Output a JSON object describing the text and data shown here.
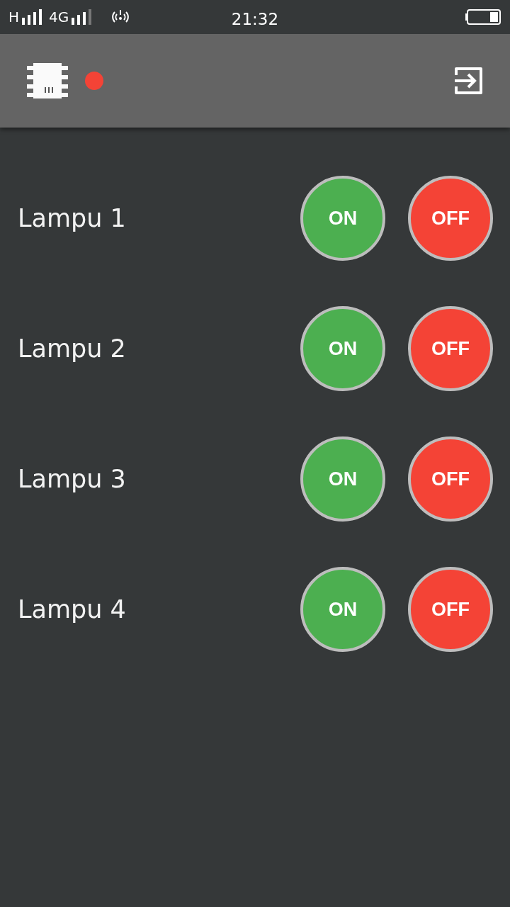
{
  "status_bar": {
    "network_1": "H",
    "network_2": "4G",
    "time": "21:32"
  },
  "toolbar": {
    "connected": false
  },
  "lamps": [
    {
      "name": "Lampu 1",
      "on_label": "ON",
      "off_label": "OFF"
    },
    {
      "name": "Lampu 2",
      "on_label": "ON",
      "off_label": "OFF"
    },
    {
      "name": "Lampu 3",
      "on_label": "ON",
      "off_label": "OFF"
    },
    {
      "name": "Lampu 4",
      "on_label": "ON",
      "off_label": "OFF"
    }
  ]
}
